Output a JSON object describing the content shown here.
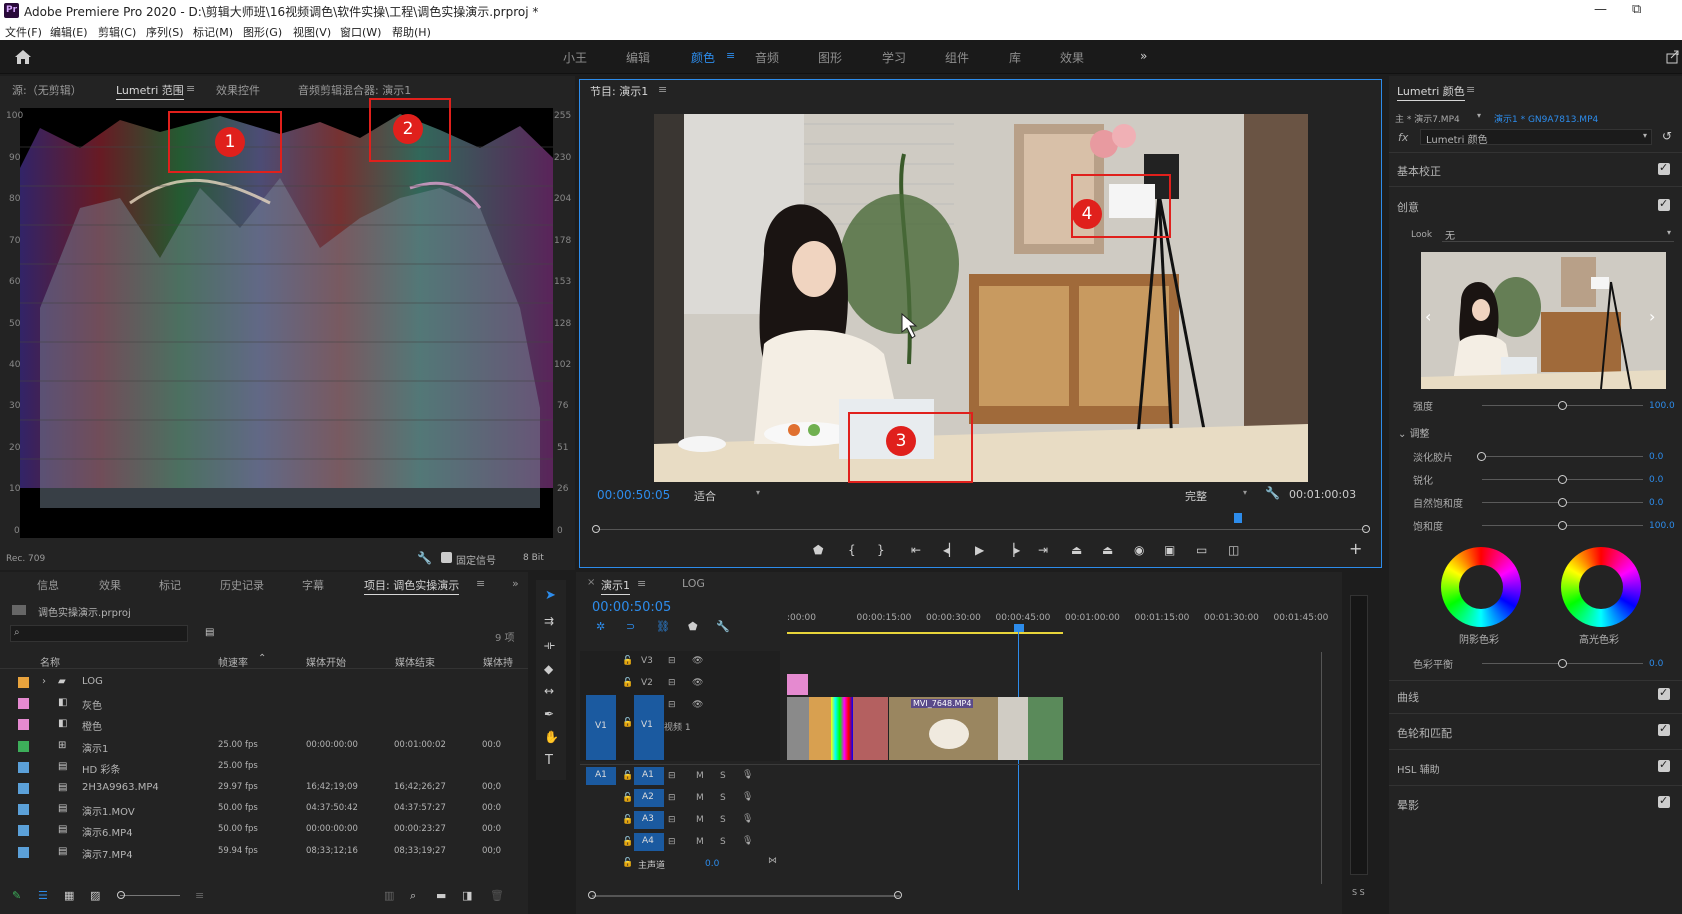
{
  "window": {
    "app_badge": "Pr",
    "title": "Adobe Premiere Pro 2020 - D:\\剪辑大师班\\16视频调色\\软件实操\\工程\\调色实操演示.prproj *",
    "min": "—",
    "max": "⧉",
    "close": "✕"
  },
  "menu": [
    "文件(F)",
    "编辑(E)",
    "剪辑(C)",
    "序列(S)",
    "标记(M)",
    "图形(G)",
    "视图(V)",
    "窗口(W)",
    "帮助(H)"
  ],
  "workspaces": [
    "小王",
    "编辑",
    "颜色",
    "音频",
    "图形",
    "学习",
    "组件",
    "库",
    "效果"
  ],
  "workspace_more": "»",
  "source_panel": {
    "tabs": [
      "源:（无剪辑）",
      "Lumetri 范围",
      "效果控件",
      "音频剪辑混合器: 演示1"
    ],
    "menu_icon": "≡",
    "left_ticks": [
      "100",
      "90",
      "80",
      "70",
      "60",
      "50",
      "40",
      "30",
      "20",
      "10",
      "0"
    ],
    "right_ticks": [
      "255",
      "230",
      "204",
      "178",
      "153",
      "128",
      "102",
      "76",
      "51",
      "26",
      "0"
    ],
    "footer_left": "Rec. 709",
    "clamp_label": "固定信号",
    "bit_depth": "8 Bit"
  },
  "program_panel": {
    "title": "节目: 演示1",
    "menu_icon": "≡",
    "timecode": "00:00:50:05",
    "fit": "适合",
    "quality": "完整",
    "duration": "00:01:00:03"
  },
  "annotations": [
    "1",
    "2",
    "3",
    "4"
  ],
  "project_panel": {
    "tabs": [
      "信息",
      "效果",
      "标记",
      "历史记录",
      "字幕",
      "项目: 调色实操演示"
    ],
    "file": "调色实操演示.prproj",
    "count": "9 项",
    "columns": [
      "名称",
      "帧速率",
      "媒体开始",
      "媒体结束",
      "媒体持"
    ],
    "rows": [
      {
        "name": "LOG",
        "fps": "",
        "start": "",
        "end": "",
        "dur": "",
        "color": "#e8a33d",
        "icon": "folder"
      },
      {
        "name": "灰色",
        "fps": "",
        "start": "",
        "end": "",
        "dur": "",
        "color": "#e58ad0",
        "icon": "matte"
      },
      {
        "name": "橙色",
        "fps": "",
        "start": "",
        "end": "",
        "dur": "",
        "color": "#e58ad0",
        "icon": "matte"
      },
      {
        "name": "演示1",
        "fps": "25.00 fps",
        "start": "00:00:00:00",
        "end": "00:01:00:02",
        "dur": "00:0",
        "color": "#3dae5a",
        "icon": "sequence"
      },
      {
        "name": "HD 彩条",
        "fps": "25.00 fps",
        "start": "",
        "end": "",
        "dur": "",
        "color": "#5ba0d8",
        "icon": "clip"
      },
      {
        "name": "2H3A9963.MP4",
        "fps": "29.97 fps",
        "start": "16;42;19;09",
        "end": "16;42;26;27",
        "dur": "00;0",
        "color": "#5ba0d8",
        "icon": "clip"
      },
      {
        "name": "演示1.MOV",
        "fps": "50.00 fps",
        "start": "04:37:50:42",
        "end": "04:37:57:27",
        "dur": "00:0",
        "color": "#5ba0d8",
        "icon": "clip"
      },
      {
        "name": "演示6.MP4",
        "fps": "50.00 fps",
        "start": "00:00:00:00",
        "end": "00:00:23:27",
        "dur": "00:0",
        "color": "#5ba0d8",
        "icon": "clip"
      },
      {
        "name": "演示7.MP4",
        "fps": "59.94 fps",
        "start": "08;33;12;16",
        "end": "08;33;19;27",
        "dur": "00;0",
        "color": "#5ba0d8",
        "icon": "clip"
      }
    ]
  },
  "timeline": {
    "tab": "演示1",
    "tab2": "LOG",
    "timecode": "00:00:50:05",
    "ruler": [
      ":00:00",
      "00:00:15:00",
      "00:00:30:00",
      "00:00:45:00",
      "00:01:00:00",
      "00:01:15:00",
      "00:01:30:00",
      "00:01:45:00"
    ],
    "video_tracks": [
      "V3",
      "V2",
      "V1"
    ],
    "audio_tracks": [
      "A1",
      "A2",
      "A3",
      "A4"
    ],
    "track_label": "视频 1",
    "master": "主声道",
    "master_val": "0.0",
    "clip_name": "MVI_7648.MP4",
    "meter": "S S"
  },
  "lumetri": {
    "title": "Lumetri 颜色",
    "menu_icon": "≡",
    "master": "主 * 演示7.MP4",
    "seq": "演示1 * GN9A7813.MP4",
    "fx": "Lumetri 颜色",
    "sections": [
      "基本校正",
      "创意",
      "曲线",
      "色轮和匹配",
      "HSL 辅助",
      "晕影"
    ],
    "look_label": "Look",
    "look_value": "无",
    "intensity": {
      "label": "强度",
      "value": "100.0",
      "fraction": 0.5
    },
    "adjust_label": "调整",
    "sliders": [
      {
        "label": "淡化胶片",
        "value": "0.0",
        "fraction": 0
      },
      {
        "label": "锐化",
        "value": "0.0",
        "fraction": 0.5
      },
      {
        "label": "自然饱和度",
        "value": "0.0",
        "fraction": 0.5
      },
      {
        "label": "饱和度",
        "value": "100.0",
        "fraction": 0.5
      }
    ],
    "wheels": [
      "阴影色彩",
      "高光色彩"
    ],
    "balance": {
      "label": "色彩平衡",
      "value": "0.0",
      "fraction": 0.5
    }
  }
}
